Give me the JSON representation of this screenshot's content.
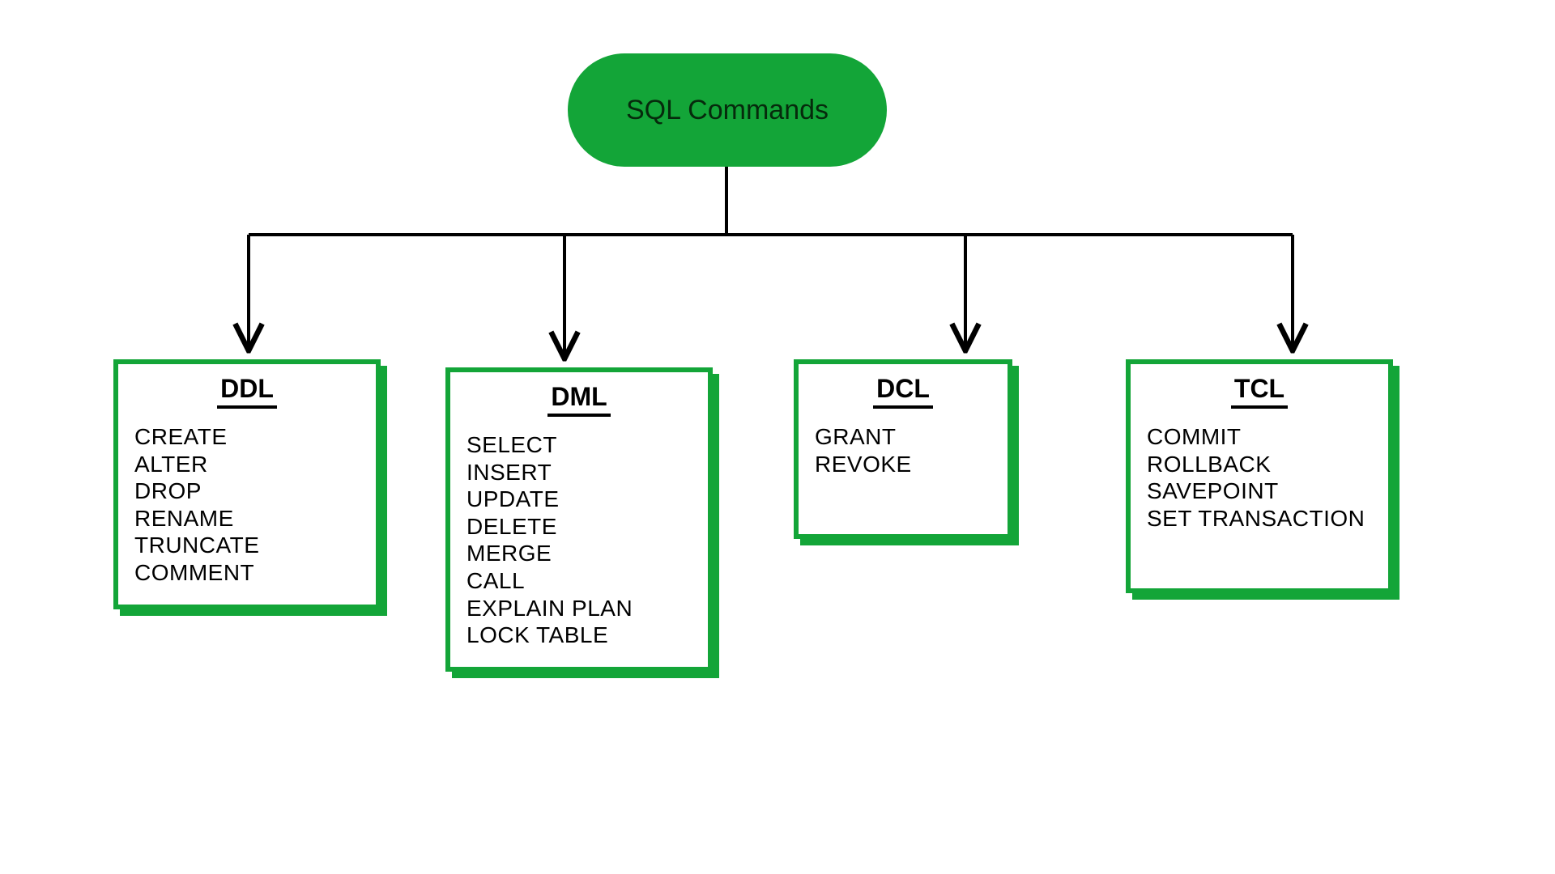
{
  "root": {
    "label": "SQL Commands"
  },
  "categories": [
    {
      "title": "DDL",
      "items": [
        "CREATE",
        "ALTER",
        "DROP",
        "RENAME",
        "TRUNCATE",
        "COMMENT"
      ]
    },
    {
      "title": "DML",
      "items": [
        "SELECT",
        "INSERT",
        "UPDATE",
        "DELETE",
        "MERGE",
        "CALL",
        "EXPLAIN PLAN",
        "LOCK TABLE"
      ]
    },
    {
      "title": "DCL",
      "items": [
        "GRANT",
        "REVOKE"
      ]
    },
    {
      "title": "TCL",
      "items": [
        "COMMIT",
        "ROLLBACK",
        "SAVEPOINT",
        "SET TRANSACTION"
      ]
    }
  ],
  "colors": {
    "accent": "#13a538",
    "text": "#000000"
  }
}
